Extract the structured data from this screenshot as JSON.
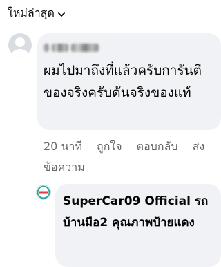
{
  "sort": {
    "label": "ใหม่ล่าสุด"
  },
  "comment": {
    "text": "ผมไปมาถึงที่แล้วครับการันตีของจริงครับดันจริงของแท้",
    "time": "20 นาที",
    "like_label": "ถูกใจ",
    "reply_label": "ตอบกลับ",
    "send_message_label": "ส่งข้อความ"
  },
  "reply": {
    "text": "SuperCar09 Official รถบ้านมือ2 คุณภาพป้ายแดง"
  }
}
